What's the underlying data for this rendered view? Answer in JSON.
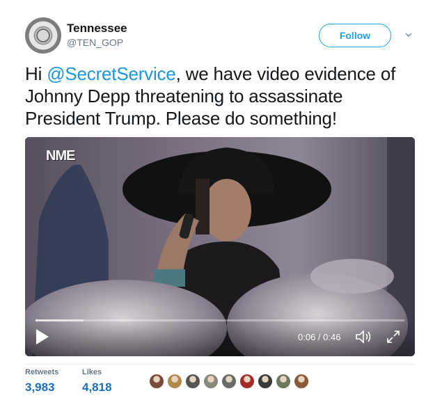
{
  "author": {
    "name": "Tennessee",
    "handle": "@TEN_GOP",
    "avatar_icon": "state-seal-icon"
  },
  "follow_label": "Follow",
  "caret_icon": "chevron-down-icon",
  "tweet_text": {
    "prefix": "Hi ",
    "mention": "@SecretService",
    "suffix": ", we have video evidence of Johnny Depp threatening to assassinate President Trump. Please do something!"
  },
  "video": {
    "watermark": "NME",
    "current_time": "0:06",
    "duration": "0:46",
    "time_display": "0:06 / 0:46",
    "progress_percent": 13,
    "play_icon": "play-icon",
    "volume_icon": "volume-icon",
    "fullscreen_icon": "fullscreen-icon"
  },
  "stats": {
    "retweets_label": "Retweets",
    "retweets_value": "3,983",
    "likes_label": "Likes",
    "likes_value": "4,818"
  },
  "likers_colors": [
    "#7a4a3a",
    "#b08a4a",
    "#555555",
    "#8a8a7a",
    "#6a6a6a",
    "#a52a2a",
    "#3a3a3a",
    "#6b7a5a",
    "#8a5a3a"
  ],
  "colors": {
    "accent": "#1da1f2",
    "mention": "#1b95e0",
    "stat_value": "#1b6fb3"
  }
}
